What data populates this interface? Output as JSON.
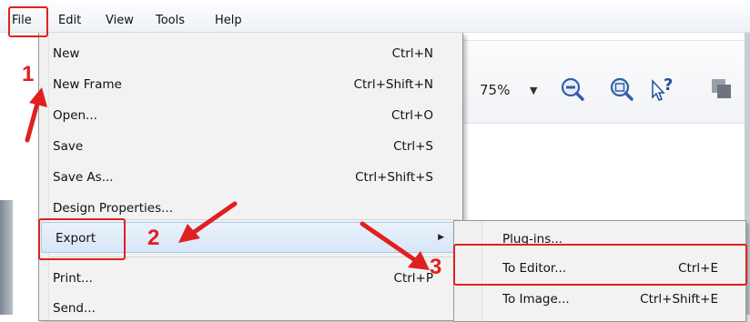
{
  "menubar": {
    "items": [
      {
        "label": "File"
      },
      {
        "label": "Edit"
      },
      {
        "label": "View"
      },
      {
        "label": "Tools"
      },
      {
        "label": "Help"
      }
    ]
  },
  "toolbar": {
    "zoom": "75%",
    "icons": [
      "zoom-out-icon",
      "zoom-in-icon",
      "help-pointer-icon",
      "copy-icon"
    ]
  },
  "file_menu": {
    "items": [
      {
        "label": "New",
        "shortcut": "Ctrl+N"
      },
      {
        "label": "New Frame",
        "shortcut": "Ctrl+Shift+N"
      },
      {
        "label": "Open...",
        "shortcut": "Ctrl+O"
      },
      {
        "label": "Save",
        "shortcut": "Ctrl+S"
      },
      {
        "label": "Save As...",
        "shortcut": "Ctrl+Shift+S"
      },
      {
        "label": "Design Properties...",
        "shortcut": ""
      },
      {
        "label": "Export",
        "shortcut": "",
        "submenu": true,
        "highlighted": true
      },
      {
        "label": "Print...",
        "shortcut": "Ctrl+P"
      },
      {
        "label": "Send...",
        "shortcut": ""
      }
    ]
  },
  "export_submenu": {
    "items": [
      {
        "label": "Plug-ins...",
        "shortcut": ""
      },
      {
        "label": "To Editor...",
        "shortcut": "Ctrl+E"
      },
      {
        "label": "To Image...",
        "shortcut": "Ctrl+Shift+E"
      }
    ]
  },
  "annotations": {
    "step1": "1",
    "step2": "2",
    "step3": "3",
    "color": "#e02020"
  }
}
